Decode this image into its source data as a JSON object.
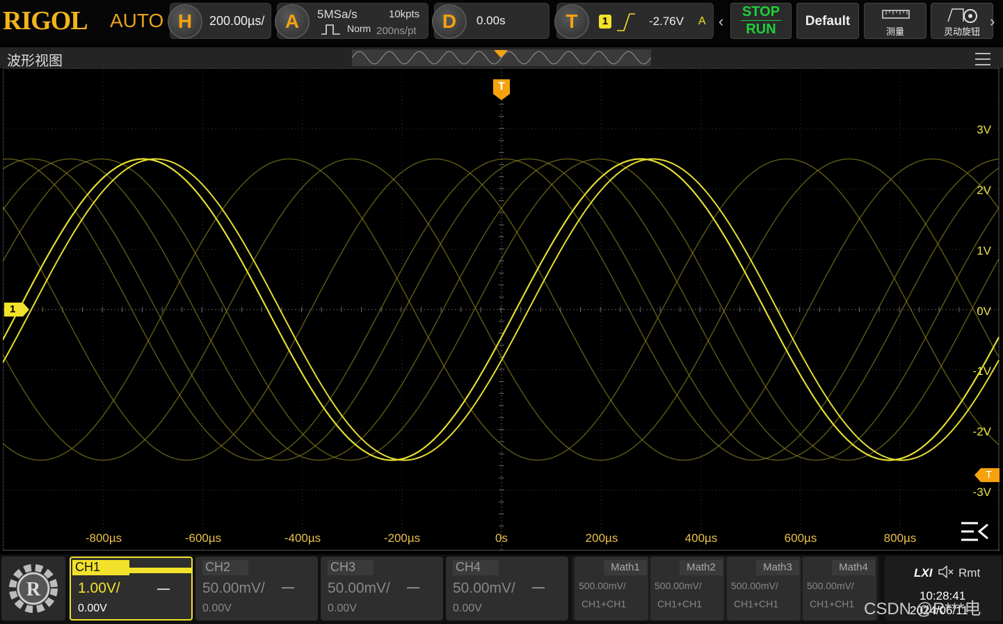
{
  "brand": {
    "logo": "RIGOL",
    "mode": "AUTO"
  },
  "horizontal": {
    "badge": "H",
    "timebase": "200.00µs/"
  },
  "acquire": {
    "badge": "A",
    "sample_rate": "5MSa/s",
    "memory": "10kpts",
    "mode": "Norm",
    "resolution": "200ns/pt"
  },
  "delay": {
    "badge": "D",
    "value": "0.00s"
  },
  "trigger": {
    "badge": "T",
    "source": "1",
    "level": "-2.76V",
    "sweep": "A"
  },
  "controls": {
    "stop": "STOP",
    "run": "RUN",
    "default": "Default",
    "measure": "测量",
    "knob": "灵动旋钮"
  },
  "window": {
    "title": "波形视图"
  },
  "scope": {
    "trigger_marker": "T",
    "ch1_marker": "1",
    "level_marker": "T",
    "y_labels": [
      "3V",
      "2V",
      "1V",
      "0V",
      "-1V",
      "-2V",
      "-3V"
    ],
    "x_labels": [
      "-800µs",
      "-600µs",
      "-400µs",
      "-200µs",
      "0s",
      "200µs",
      "400µs",
      "600µs",
      "800µs"
    ]
  },
  "channels": [
    {
      "name": "CH1",
      "scale": "1.00V/",
      "offset": "0.00V",
      "active": true
    },
    {
      "name": "CH2",
      "scale": "50.00mV/",
      "offset": "0.00V",
      "active": false
    },
    {
      "name": "CH3",
      "scale": "50.00mV/",
      "offset": "0.00V",
      "active": false
    },
    {
      "name": "CH4",
      "scale": "50.00mV/",
      "offset": "0.00V",
      "active": false
    }
  ],
  "math": [
    {
      "name": "Math1",
      "scale": "500.00mV/",
      "source": "CH1+CH1"
    },
    {
      "name": "Math2",
      "scale": "500.00mV/",
      "source": "CH1+CH1"
    },
    {
      "name": "Math3",
      "scale": "500.00mV/",
      "source": "CH1+CH1"
    },
    {
      "name": "Math4",
      "scale": "500.00mV/",
      "source": "CH1+CH1"
    }
  ],
  "status": {
    "lxi": "LXI",
    "remote": "Rmt",
    "time": "10:28:41",
    "date": "2024/06/11",
    "watermark": "CSDN @R***电"
  },
  "colors": {
    "ch1": "#f2e22b",
    "accent": "#f5a20e",
    "run": "#1fcf3a"
  }
}
